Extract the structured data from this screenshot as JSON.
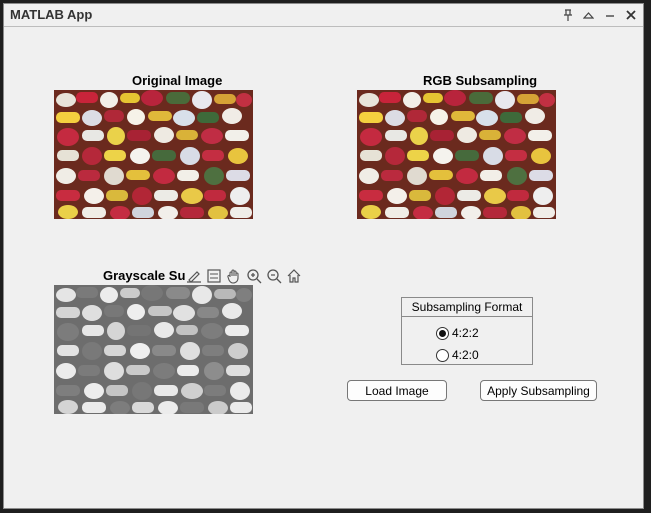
{
  "window": {
    "title": "MATLAB App"
  },
  "titlebar_icons": [
    "pin-icon",
    "collapse-icon",
    "minimize-icon",
    "close-icon"
  ],
  "axes": {
    "original_title": "Original Image",
    "rgb_title": "RGB Subsampling",
    "gray_title": "Grayscale Su"
  },
  "axes_toolbar": [
    "brush-icon",
    "data-tip-icon",
    "pan-icon",
    "zoom-in-icon",
    "zoom-out-icon",
    "home-icon"
  ],
  "subsampling_group": {
    "title": "Subsampling Format",
    "options": [
      {
        "label": "4:2:2",
        "selected": true
      },
      {
        "label": "4:2:0",
        "selected": false
      }
    ]
  },
  "buttons": {
    "load": "Load Image",
    "apply": "Apply Subsampling"
  }
}
